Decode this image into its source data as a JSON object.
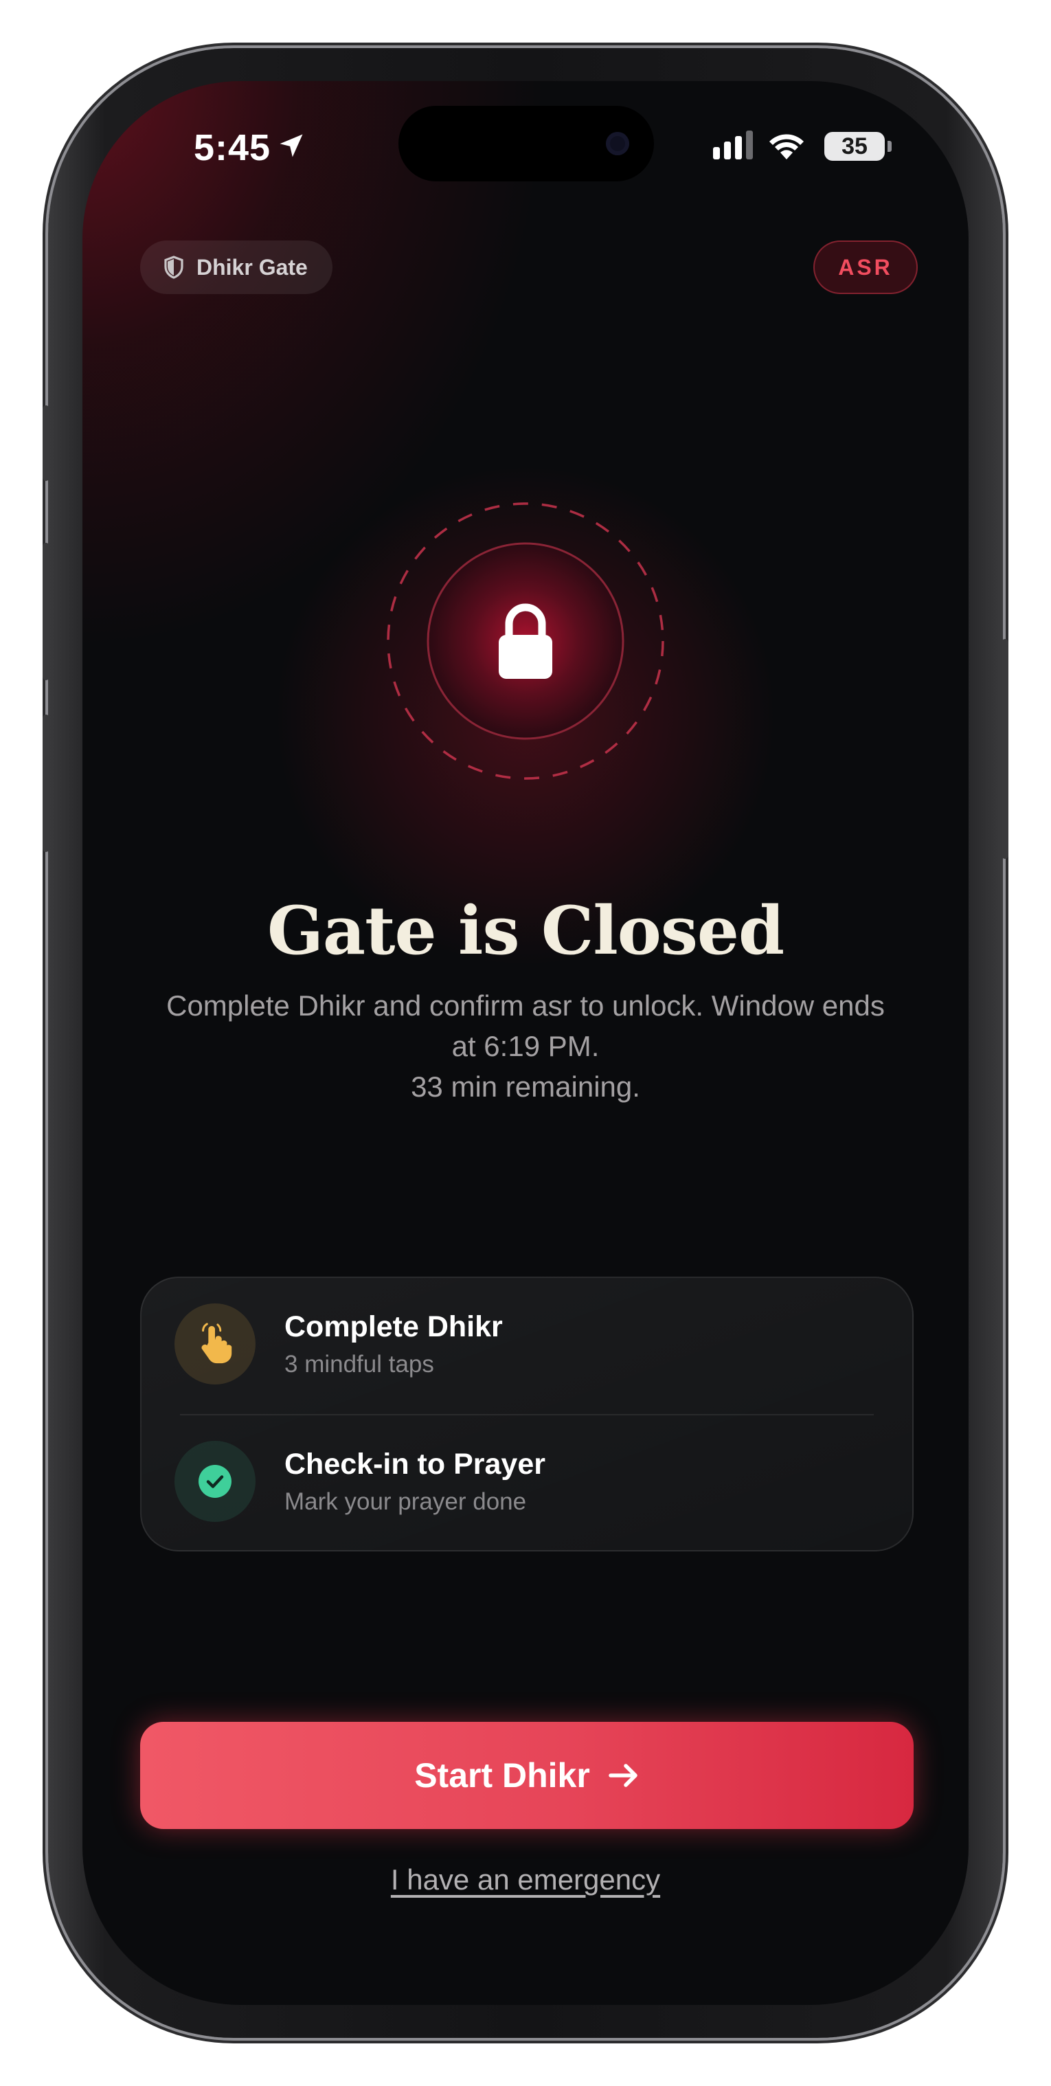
{
  "status_bar": {
    "time": "5:45",
    "battery": "35"
  },
  "header": {
    "app_chip_label": "Dhikr Gate",
    "prayer_chip_label": "ASR"
  },
  "main": {
    "title": "Gate is Closed",
    "subtitle_line1": "Complete Dhikr and confirm asr to unlock. Window ends at 6:19 PM.",
    "subtitle_line2": "33 min remaining."
  },
  "steps": [
    {
      "title": "Complete Dhikr",
      "subtitle": "3 mindful taps",
      "icon": "tap-hand-icon"
    },
    {
      "title": "Check-in to Prayer",
      "subtitle": "Mark your prayer done",
      "icon": "check-circle-icon"
    }
  ],
  "actions": {
    "primary_label": "Start Dhikr",
    "emergency_label": "I have an emergency"
  },
  "colors": {
    "accent": "#e64558",
    "accent_dark": "#d72840",
    "title": "#f3eedf",
    "background": "#0a0b0d",
    "dhikr_icon": "#f2b84b",
    "check_icon": "#3fcf9a"
  }
}
